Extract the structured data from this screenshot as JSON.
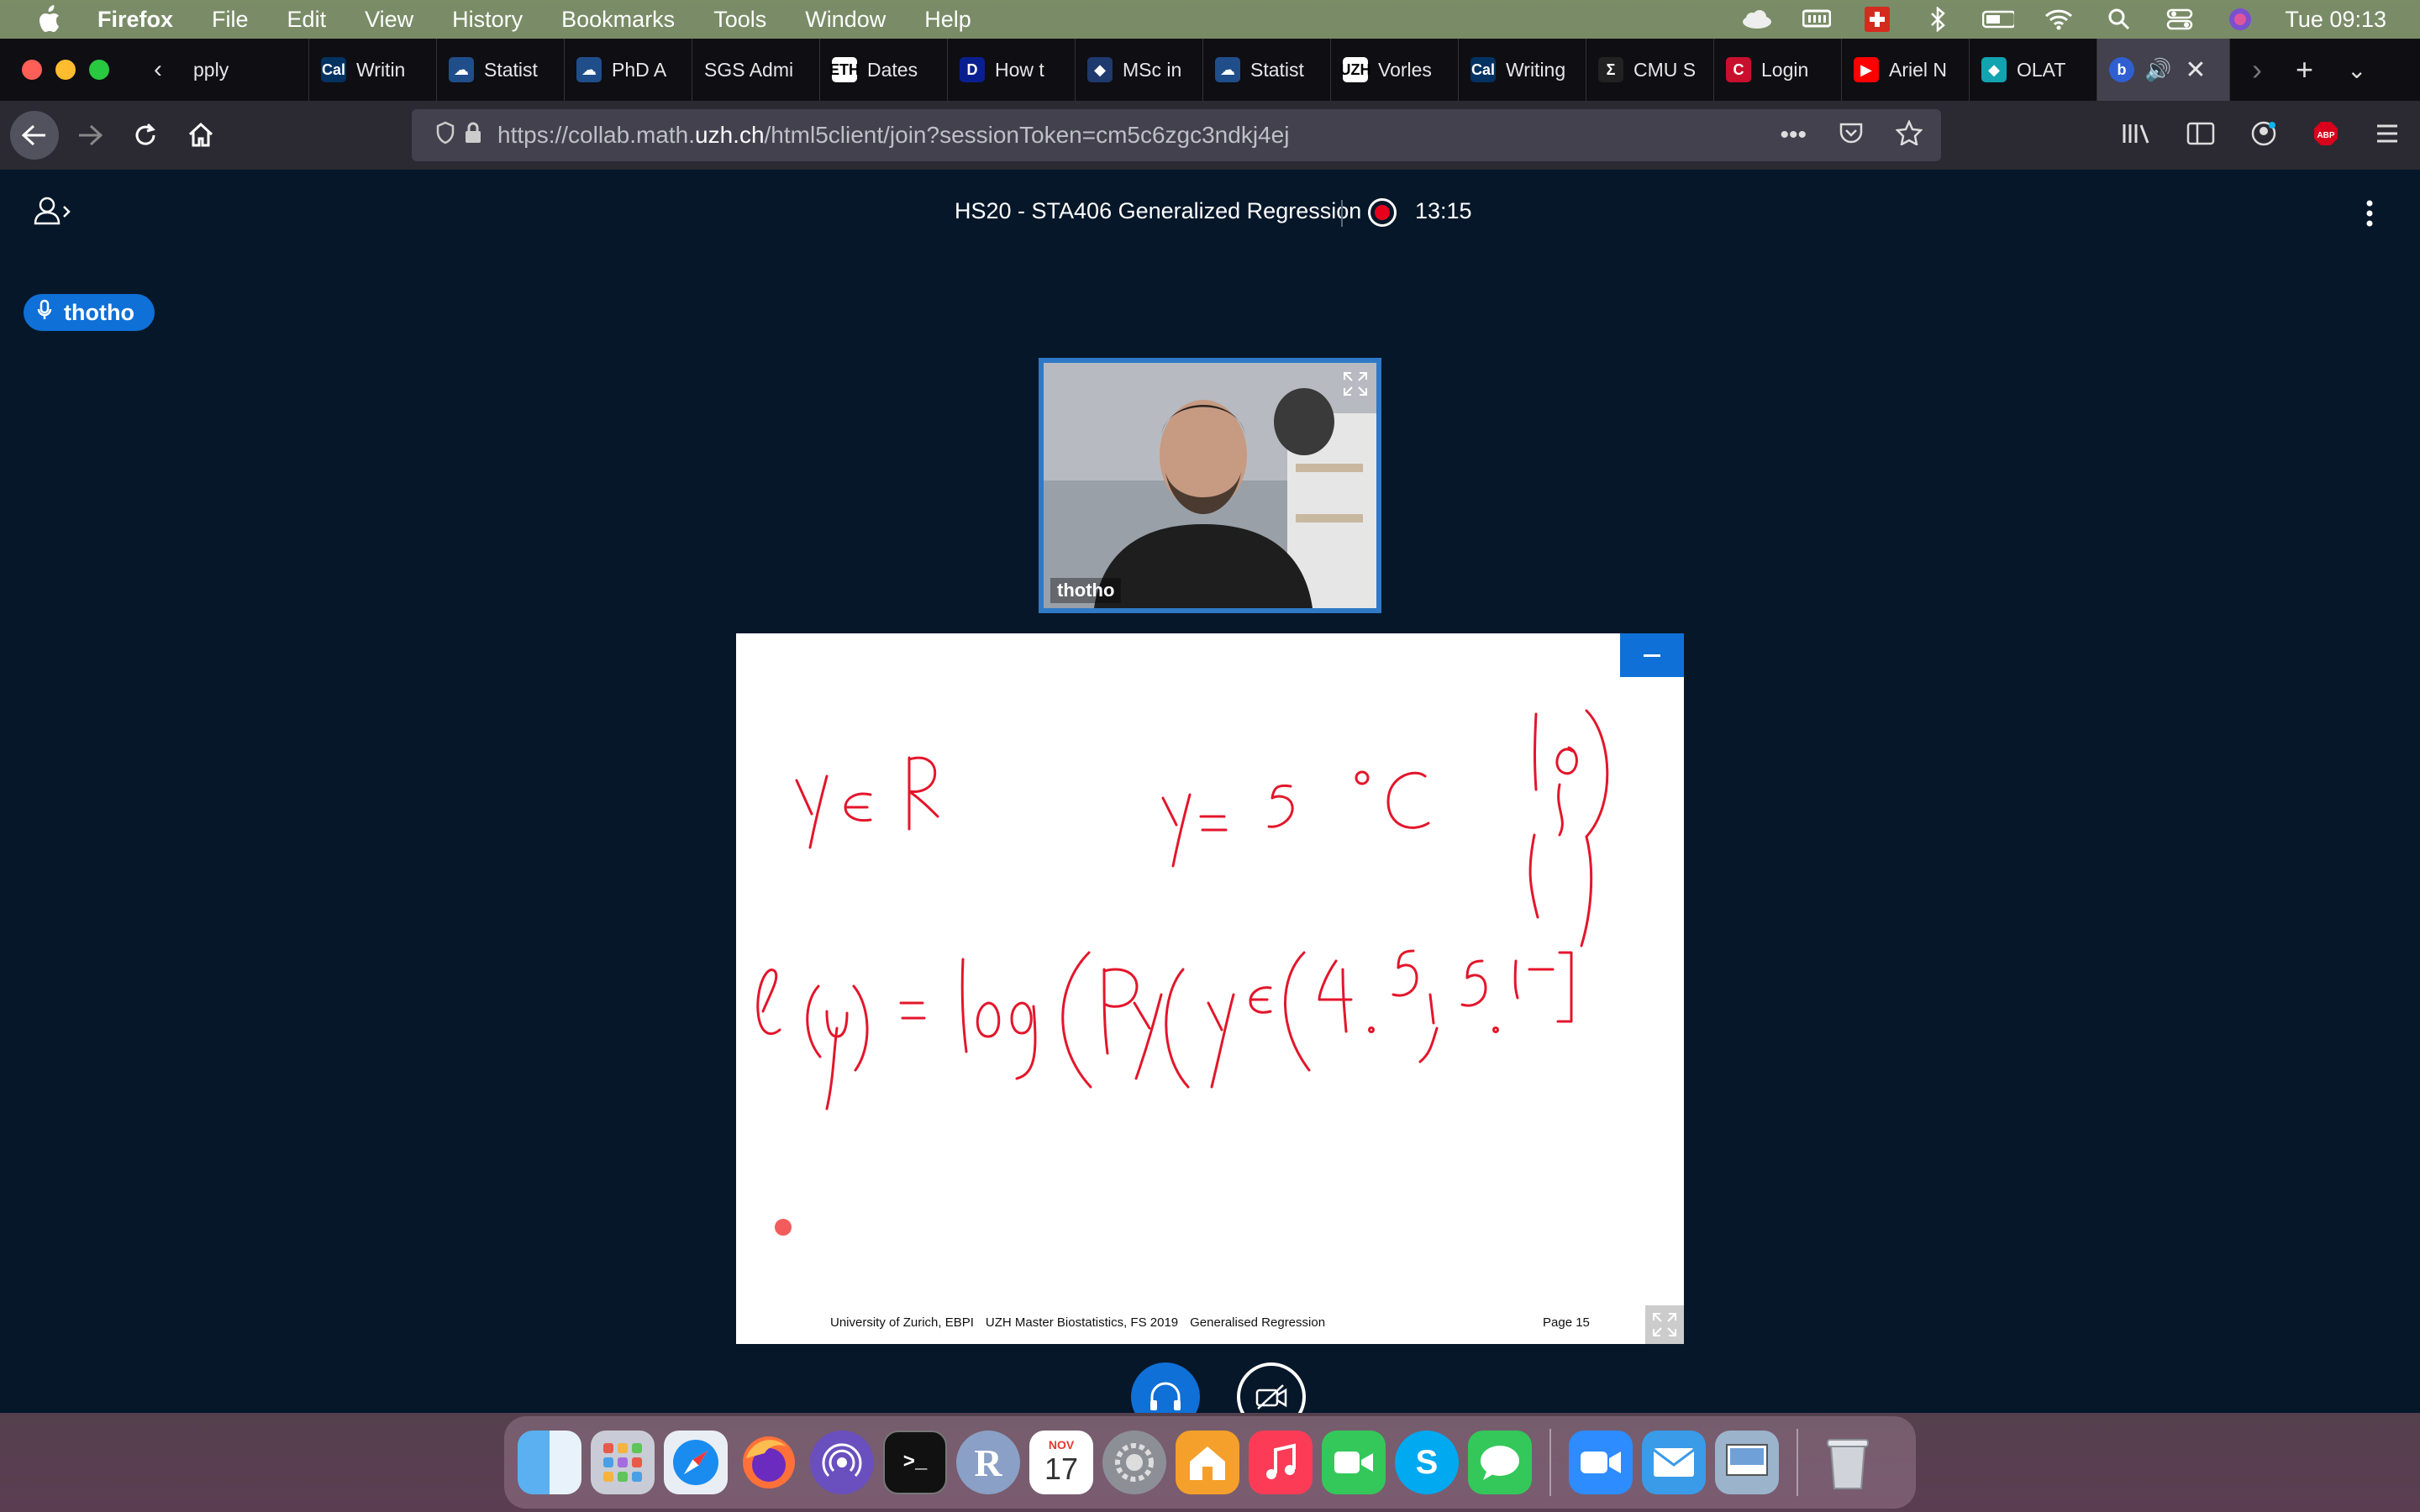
{
  "menubar": {
    "app": "Firefox",
    "items": [
      "File",
      "Edit",
      "View",
      "History",
      "Bookmarks",
      "Tools",
      "Window",
      "Help"
    ],
    "clock": "Tue 09:13"
  },
  "tabs": [
    {
      "label": "pply",
      "fav": "",
      "fav_color": "#0f0e13"
    },
    {
      "label": "Writin",
      "fav": "Cal",
      "fav_color": "#003262"
    },
    {
      "label": "Statist",
      "fav": "☁",
      "fav_color": "#1f4e8a"
    },
    {
      "label": "PhD A",
      "fav": "☁",
      "fav_color": "#1f4e8a"
    },
    {
      "label": "SGS Admi",
      "fav": "",
      "fav_color": "#0f0e13"
    },
    {
      "label": "Dates",
      "fav": "ETH",
      "fav_color": "#ffffff"
    },
    {
      "label": "How t",
      "fav": "D",
      "fav_color": "#0a1f8f"
    },
    {
      "label": "MSc in",
      "fav": "◆",
      "fav_color": "#1e3a6e"
    },
    {
      "label": "Statist",
      "fav": "☁",
      "fav_color": "#1f4e8a"
    },
    {
      "label": "Vorles",
      "fav": "UZH",
      "fav_color": "#ffffff"
    },
    {
      "label": "Writing",
      "fav": "Cal",
      "fav_color": "#003262"
    },
    {
      "label": "CMU S",
      "fav": "Σ",
      "fav_color": "#222222"
    },
    {
      "label": "Login",
      "fav": "C",
      "fav_color": "#c8102e"
    },
    {
      "label": "Ariel N",
      "fav": "▶",
      "fav_color": "#ff0000"
    },
    {
      "label": "OLAT",
      "fav": "◆",
      "fav_color": "#12a3b0"
    }
  ],
  "active_tab_fav": "b",
  "url": {
    "prefix": "https://collab.math.",
    "domain": "uzh.ch",
    "path": "/html5client/join?sessionToken=cm5c6zgc3ndkj4ej"
  },
  "meeting": {
    "title": "HS20 - STA406 Generalized Regression",
    "recording_time": "13:15",
    "talker": "thotho",
    "webcam_name": "thotho"
  },
  "slide": {
    "footer_items": [
      "University of Zurich, EBPI",
      "UZH Master Biostatistics, FS 2019",
      "Generalised Regression"
    ],
    "page": "Page 15"
  },
  "dock": {
    "calendar_month": "NOV",
    "calendar_day": "17",
    "r_label": "R"
  }
}
